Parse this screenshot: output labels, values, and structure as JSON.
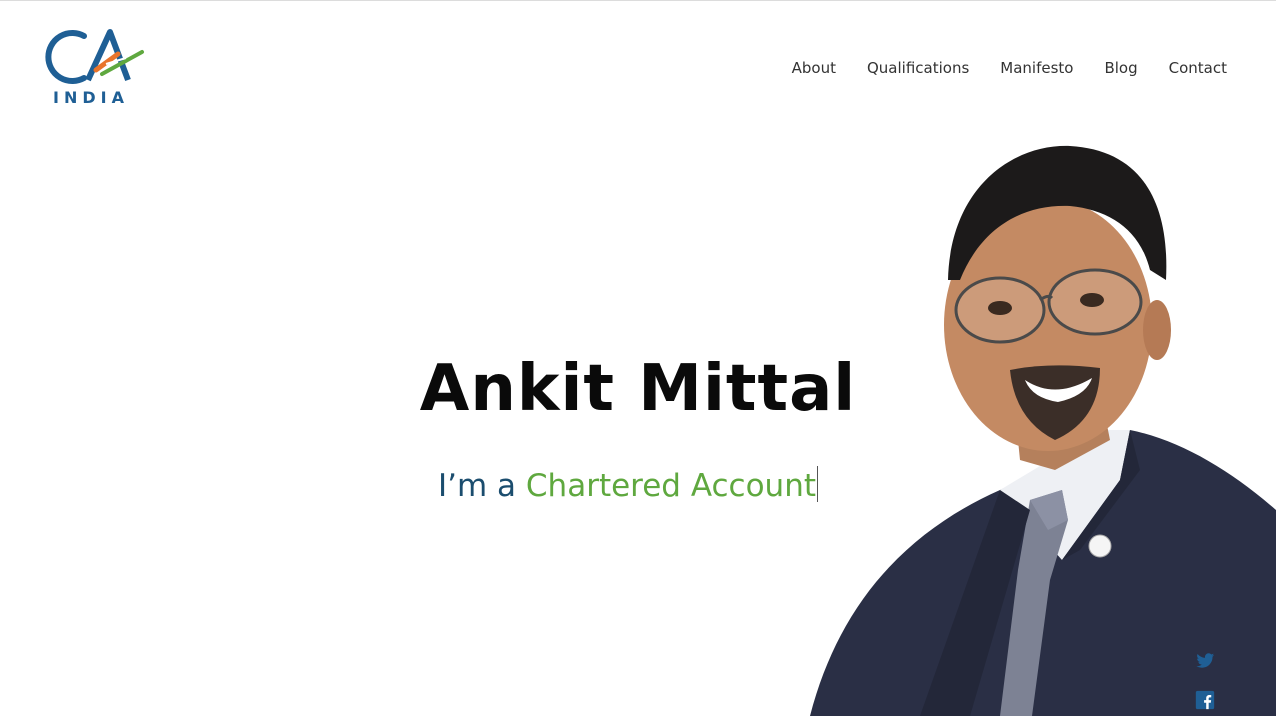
{
  "brand": {
    "logo_text": "INDIA"
  },
  "nav": {
    "items": [
      {
        "label": "About"
      },
      {
        "label": "Qualifications"
      },
      {
        "label": "Manifesto"
      },
      {
        "label": "Blog"
      },
      {
        "label": "Contact"
      }
    ]
  },
  "hero": {
    "name": "Ankit Mittal",
    "intro_prefix": "I’m a",
    "intro_role": "Chartered Account"
  },
  "social": [
    "twitter-icon",
    "facebook-icon"
  ],
  "colors": {
    "brand_blue": "#1f5f95",
    "accent_green": "#5fa83f",
    "subtitle_navy": "#1b4d6e",
    "logo_orange": "#e9742b",
    "suit": "#2a2f45"
  }
}
